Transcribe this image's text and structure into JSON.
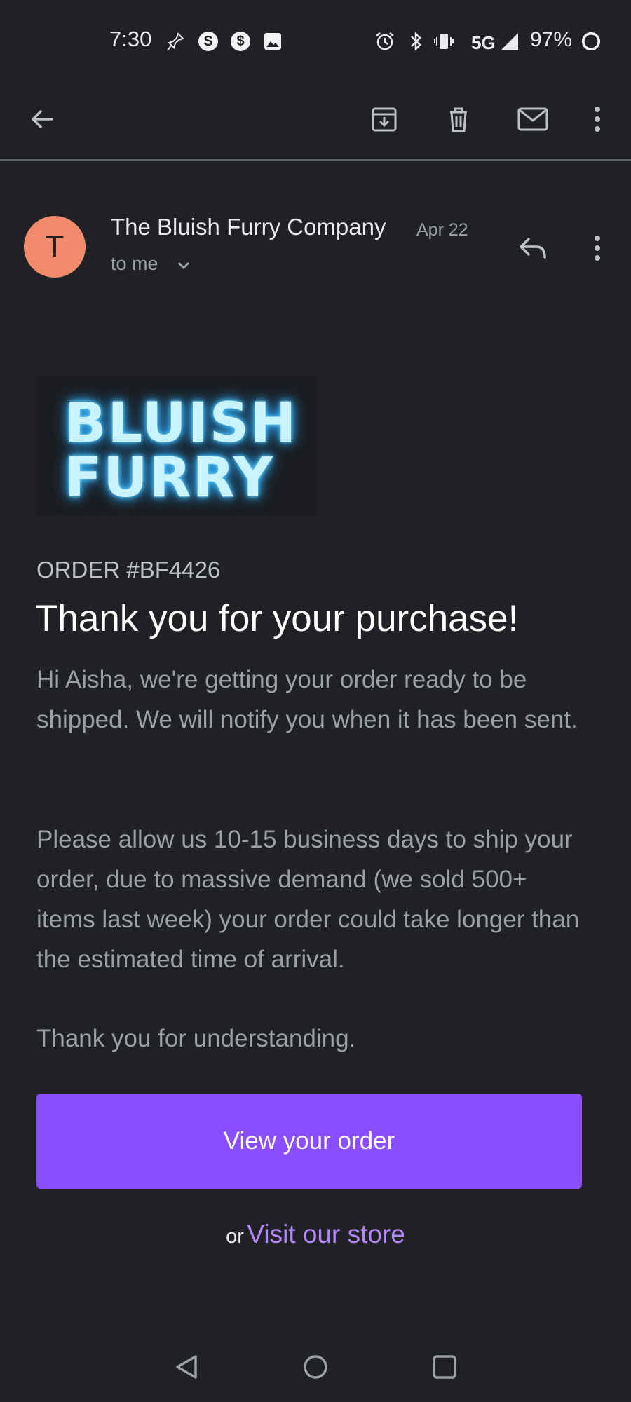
{
  "status_bar": {
    "time": "7:30",
    "network": "5G",
    "battery": "97%"
  },
  "email": {
    "avatar_letter": "T",
    "sender": "The Bluish Furry Company",
    "date": "Apr 22",
    "recipient": "to me",
    "logo_lines": [
      "BLUISH",
      "FURRY"
    ],
    "order_number": "ORDER #BF4426",
    "headline": "Thank you for your purchase!",
    "paragraphs": [
      "Hi Aisha, we're getting your order ready to be shipped. We will notify you when it has been sent.",
      "Please allow us 10-15 business days to ship your order, due to massive demand (we sold 500+ items last week) your order could take longer than the estimated time of arrival.",
      "Thank you for understanding."
    ],
    "cta_label": "View your order",
    "or_text": "or",
    "store_link": "Visit our store"
  },
  "colors": {
    "background": "#202124",
    "avatar": "#f28b6b",
    "cta": "#8a4dff",
    "link": "#b388ff",
    "logo_glow": "#5fd3ff"
  },
  "icons": {
    "toolbar": [
      "back-arrow-icon",
      "archive-icon",
      "trash-icon",
      "mark-unread-icon",
      "more-vert-icon"
    ],
    "sender_row": [
      "reply-icon",
      "more-vert-icon"
    ],
    "nav": [
      "back-triangle-icon",
      "home-circle-icon",
      "recents-square-icon"
    ]
  }
}
